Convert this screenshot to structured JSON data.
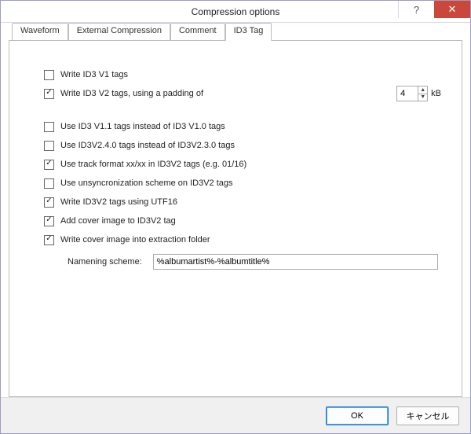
{
  "window": {
    "title": "Compression options"
  },
  "titlebar_buttons": {
    "help": "?",
    "close": "✕"
  },
  "tabs": [
    {
      "label": "Waveform",
      "active": false
    },
    {
      "label": "External Compression",
      "active": false
    },
    {
      "label": "Comment",
      "active": false
    },
    {
      "label": "ID3 Tag",
      "active": true
    }
  ],
  "options": {
    "write_v1": {
      "label": "Write ID3 V1 tags",
      "checked": false
    },
    "write_v2": {
      "label": "Write ID3 V2 tags, using a padding of",
      "checked": true
    },
    "padding_value": "4",
    "padding_unit": "kB",
    "use_v11": {
      "label": "Use ID3 V1.1 tags instead of ID3 V1.0 tags",
      "checked": false
    },
    "use_v240": {
      "label": "Use ID3V2.4.0 tags instead of ID3V2.3.0 tags",
      "checked": false
    },
    "track_format": {
      "label": "Use track format xx/xx in ID3V2 tags (e.g. 01/16)",
      "checked": true
    },
    "unsync": {
      "label": "Use unsyncronization scheme on ID3V2 tags",
      "checked": false
    },
    "utf16": {
      "label": "Write ID3V2 tags using UTF16",
      "checked": true
    },
    "cover_in_tag": {
      "label": "Add cover image to ID3V2 tag",
      "checked": true
    },
    "cover_extract": {
      "label": "Write cover image into extraction folder",
      "checked": true
    },
    "naming_label": "Namening scheme:",
    "naming_value": "%albumartist%-%albumtitle%"
  },
  "footer": {
    "ok": "OK",
    "cancel": "キャンセル"
  }
}
